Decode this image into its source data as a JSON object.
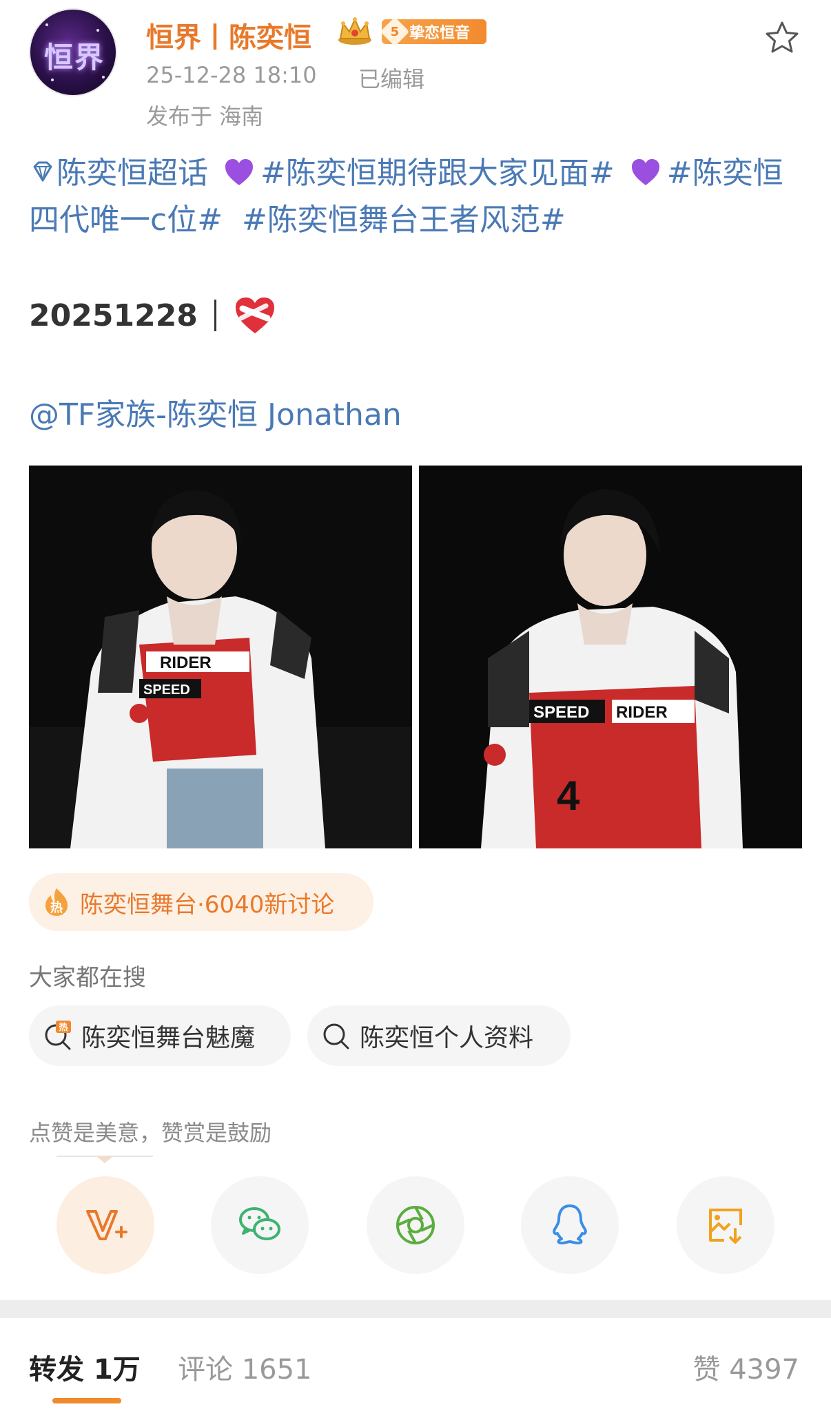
{
  "header": {
    "avatar_text": "恒界",
    "user_name": "恒界丨陈奕恒",
    "fan_badge": {
      "level": "5",
      "label": "挚恋恒音"
    },
    "timestamp": "25-12-28 18:10",
    "edited": "已编辑",
    "location": "发布于 海南",
    "icons": {
      "favorite": "star-icon",
      "crown": "crown-icon"
    }
  },
  "post": {
    "topics": {
      "super_topic": "陈奕恒超话",
      "topic_1": "#陈奕恒期待跟大家见面#",
      "topic_2": "#陈奕恒 四代唯一c位#",
      "topic_3": "#陈奕恒舞台王者风范#"
    },
    "date_text": "20251228",
    "mention": "@TF家族-陈奕恒 Jonathan",
    "photos": [
      "photo-1",
      "photo-2"
    ]
  },
  "hot_topic": {
    "text": "陈奕恒舞台·6040新讨论",
    "icon": "hot-icon"
  },
  "search": {
    "label": "大家都在搜",
    "chips": [
      {
        "text": "陈奕恒舞台魅魔",
        "icon": "hot-search-icon"
      },
      {
        "text": "陈奕恒个人资料",
        "icon": "search-icon"
      }
    ]
  },
  "reward": {
    "text": "点赞是美意，赞赏是鼓励"
  },
  "share": {
    "buttons": [
      "reward-v-icon",
      "wechat-icon",
      "moments-icon",
      "qq-icon",
      "save-image-icon"
    ]
  },
  "tabs": {
    "repost": "转发 1万",
    "comment": "评论 1651",
    "like": "赞 4397"
  },
  "colors": {
    "accent": "#e8792b",
    "link": "#4a79b5",
    "heart_purple": "#9b4fe0"
  }
}
